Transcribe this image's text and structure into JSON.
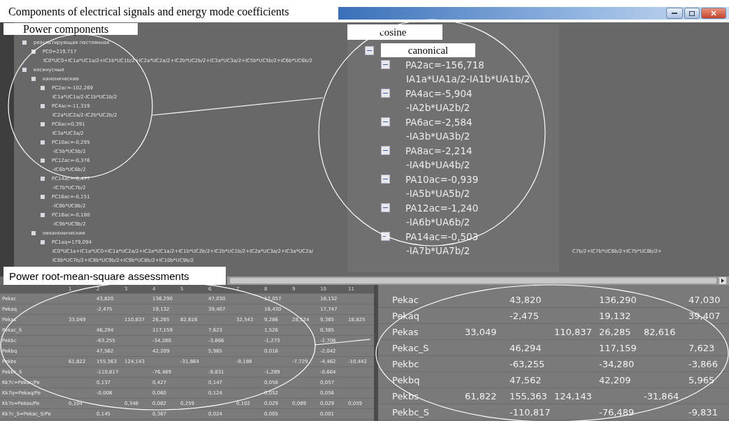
{
  "window": {
    "title": "Components of electrical signals and energy mode coefficients"
  },
  "labels": {
    "power_components": "Power components",
    "cosine": "cosine",
    "rms": "Power root-mean-square assessments"
  },
  "tree": {
    "items": [
      {
        "label": "результирующая постоянная",
        "expanded": true,
        "children": [
          {
            "label": "PC0=219,717",
            "expanded": true,
            "children": [
              {
                "lines": [
                  "IC0*UC0+IC1a*UC1a/2+IC1b*UC1b/2+IC2a*UC2a/2+IC2b*UC2b/2+IC3a*UC3a/2+IC5b*UC5b/2+IC6b*UC6b/2"
                ]
              }
            ]
          }
        ]
      },
      {
        "label": "косинусные",
        "expanded": true,
        "children": [
          {
            "label": "канонические",
            "expanded": true,
            "children": [
              {
                "label": "PC2ac=-102,269",
                "expanded": true,
                "children": [
                  {
                    "lines": [
                      "IC1a*UC1a/2-IC1b*UC1b/2"
                    ]
                  }
                ]
              },
              {
                "label": "PC4ac=-11,319",
                "expanded": true,
                "children": [
                  {
                    "lines": [
                      "IC2a*UC2a/2-IC2b*UC2b/2"
                    ]
                  }
                ]
              },
              {
                "label": "PC6ac=0,391",
                "expanded": true,
                "children": [
                  {
                    "lines": [
                      "IC3a*UC3a/2"
                    ]
                  }
                ]
              },
              {
                "label": "PC10ac=-0,295",
                "expanded": true,
                "children": [
                  {
                    "lines": [
                      "-IC5b*UC5b/2"
                    ]
                  }
                ]
              },
              {
                "label": "PC12ac=-0,376",
                "expanded": true,
                "children": [
                  {
                    "lines": [
                      "-IC6b*UC6b/2"
                    ]
                  }
                ]
              },
              {
                "label": "PC14ac=-0,477",
                "expanded": true,
                "children": [
                  {
                    "lines": [
                      "-IC7b*UC7b/2"
                    ]
                  }
                ]
              },
              {
                "label": "PC16ac=-0,151",
                "expanded": true,
                "children": [
                  {
                    "lines": [
                      "-IC8b*UC8b/2"
                    ]
                  }
                ]
              },
              {
                "label": "PC18ac=-0,180",
                "expanded": true,
                "children": [
                  {
                    "lines": [
                      "-IC9b*UC9b/2"
                    ]
                  }
                ]
              }
            ]
          },
          {
            "label": "неканонические",
            "expanded": true,
            "children": [
              {
                "label": "PC1aq=179,094",
                "expanded": true,
                "children": [
                  {
                    "lines": [
                      "IC0*UC1a+IC1a*UC0+IC1a*UC2a/2+IC2a*UC1a/2+IC1b*UC2b/2+IC2b*UC1b/2+IC2a*UC3a/2+IC3a*UC2a/",
                      "IC8b*UC7b/2+IC8b*UC9b/2+IC9b*UC8b/2+IC10b*UC9b/2"
                    ],
                    "tail": "C7b/2+IC7b*UC6b/2+IC7b*UC8b/2+"
                  }
                ]
              }
            ]
          }
        ]
      }
    ]
  },
  "zoom_tree": {
    "items": [
      {
        "label": "canonical",
        "expanded": true,
        "children": [
          {
            "label": "PA2ac=-156,718",
            "expanded": true,
            "children": [
              {
                "lines": [
                  "IA1a*UA1a/2-IA1b*UA1b/2"
                ]
              }
            ]
          },
          {
            "label": "PA4ac=-5,904",
            "expanded": true,
            "children": [
              {
                "lines": [
                  "-IA2b*UA2b/2"
                ]
              }
            ]
          },
          {
            "label": "PA6ac=-2,584",
            "expanded": true,
            "children": [
              {
                "lines": [
                  "-IA3b*UA3b/2"
                ]
              }
            ]
          },
          {
            "label": "PA8ac=-2,214",
            "expanded": true,
            "children": [
              {
                "lines": [
                  "-IA4b*UA4b/2"
                ]
              }
            ]
          },
          {
            "label": "PA10ac=-0,939",
            "expanded": true,
            "children": [
              {
                "lines": [
                  "-IA5b*UA5b/2"
                ]
              }
            ]
          },
          {
            "label": "PA12ac=-1,240",
            "expanded": true,
            "children": [
              {
                "lines": [
                  "-IA6b*UA6b/2"
                ]
              }
            ]
          },
          {
            "label": "PA14ac=-0,503",
            "expanded": true,
            "children": [
              {
                "lines": [
                  "-IA7b*UA7b/2"
                ]
              }
            ]
          }
        ]
      }
    ]
  },
  "table": {
    "columns": [
      "1",
      "2",
      "3",
      "4",
      "5",
      "6",
      "7",
      "8",
      "9",
      "10",
      "11"
    ],
    "rows": [
      {
        "name": "Pekac",
        "cells": [
          null,
          "43,820",
          null,
          "136,290",
          null,
          "47,030",
          null,
          "17,057",
          null,
          "18,132",
          null
        ]
      },
      {
        "name": "Pekaq",
        "cells": [
          null,
          "-2,475",
          null,
          "19,132",
          null,
          "39,407",
          null,
          "16,430",
          null,
          "17,747",
          null
        ]
      },
      {
        "name": "Pekas",
        "cells": [
          "33,049",
          null,
          "110,837",
          "26,285",
          "82,616",
          null,
          "32,543",
          "9,266",
          "28,524",
          "9,365",
          "18,825"
        ]
      },
      {
        "name": "Pekac_S",
        "cells": [
          null,
          "46,294",
          null,
          "117,159",
          null,
          "7,623",
          null,
          "1,526",
          null,
          "0,385",
          null
        ]
      },
      {
        "name": "Pekbc",
        "cells": [
          null,
          "-63,255",
          null,
          "-34,280",
          null,
          "-3,866",
          null,
          "-1,273",
          null,
          "-2,706",
          null
        ]
      },
      {
        "name": "Pekbq",
        "cells": [
          null,
          "47,562",
          null,
          "42,209",
          null,
          "5,965",
          null,
          "0,016",
          null,
          "-2,042",
          null
        ]
      },
      {
        "name": "Pekbs",
        "cells": [
          "61,822",
          "155,363",
          "124,143",
          null,
          "-31,864",
          null,
          "-9,188",
          null,
          "-7,729",
          "-4,462",
          "-10,442"
        ]
      },
      {
        "name": "Pekbc_S",
        "cells": [
          null,
          "-110,817",
          null,
          "-76,489",
          null,
          "-9,831",
          null,
          "-1,289",
          null,
          "-0,664",
          null
        ]
      },
      {
        "name": "Kk7c=Pekac/Pe",
        "cells": [
          null,
          "0,137",
          null,
          "0,427",
          null,
          "0,147",
          null,
          "0,056",
          null,
          "0,057",
          null
        ]
      },
      {
        "name": "Kk7q=Pekaq/Pe",
        "cells": [
          null,
          "-0,008",
          null,
          "0,060",
          null,
          "0,124",
          null,
          "0,052",
          null,
          "0,056",
          null
        ]
      },
      {
        "name": "Kk7s=Pekas/Pe",
        "cells": [
          "0,104",
          null,
          "0,348",
          "0,082",
          "0,259",
          null,
          "0,102",
          "0,029",
          "0,089",
          "0,029",
          "0,059"
        ]
      },
      {
        "name": "Kk7c_S=Pekac_S/Pe",
        "cells": [
          null,
          "0,145",
          null,
          "0,367",
          null,
          "0,024",
          null,
          "0,005",
          null,
          "0,001",
          null
        ]
      }
    ]
  },
  "zoom_table": {
    "rows": [
      {
        "name": "Pekac",
        "cells": [
          null,
          "43,820",
          null,
          "136,290",
          null,
          "47,030"
        ]
      },
      {
        "name": "Pekaq",
        "cells": [
          null,
          "-2,475",
          null,
          "19,132",
          null,
          "39,407"
        ]
      },
      {
        "name": "Pekas",
        "cells": [
          "33,049",
          null,
          "110,837",
          "26,285",
          "82,616",
          null
        ]
      },
      {
        "name": "Pekac_S",
        "cells": [
          null,
          "46,294",
          null,
          "117,159",
          null,
          "7,623"
        ]
      },
      {
        "name": "Pekbc",
        "cells": [
          null,
          "-63,255",
          null,
          "-34,280",
          null,
          "-3,866"
        ]
      },
      {
        "name": "Pekbq",
        "cells": [
          null,
          "47,562",
          null,
          "42,209",
          null,
          "5,965"
        ]
      },
      {
        "name": "Pekbs",
        "cells": [
          "61,822",
          "155,363",
          "124,143",
          null,
          "-31,864",
          null
        ]
      },
      {
        "name": "Pekbc_S",
        "cells": [
          null,
          "-110,817",
          null,
          "-76,489",
          null,
          "-9,831"
        ]
      }
    ]
  }
}
